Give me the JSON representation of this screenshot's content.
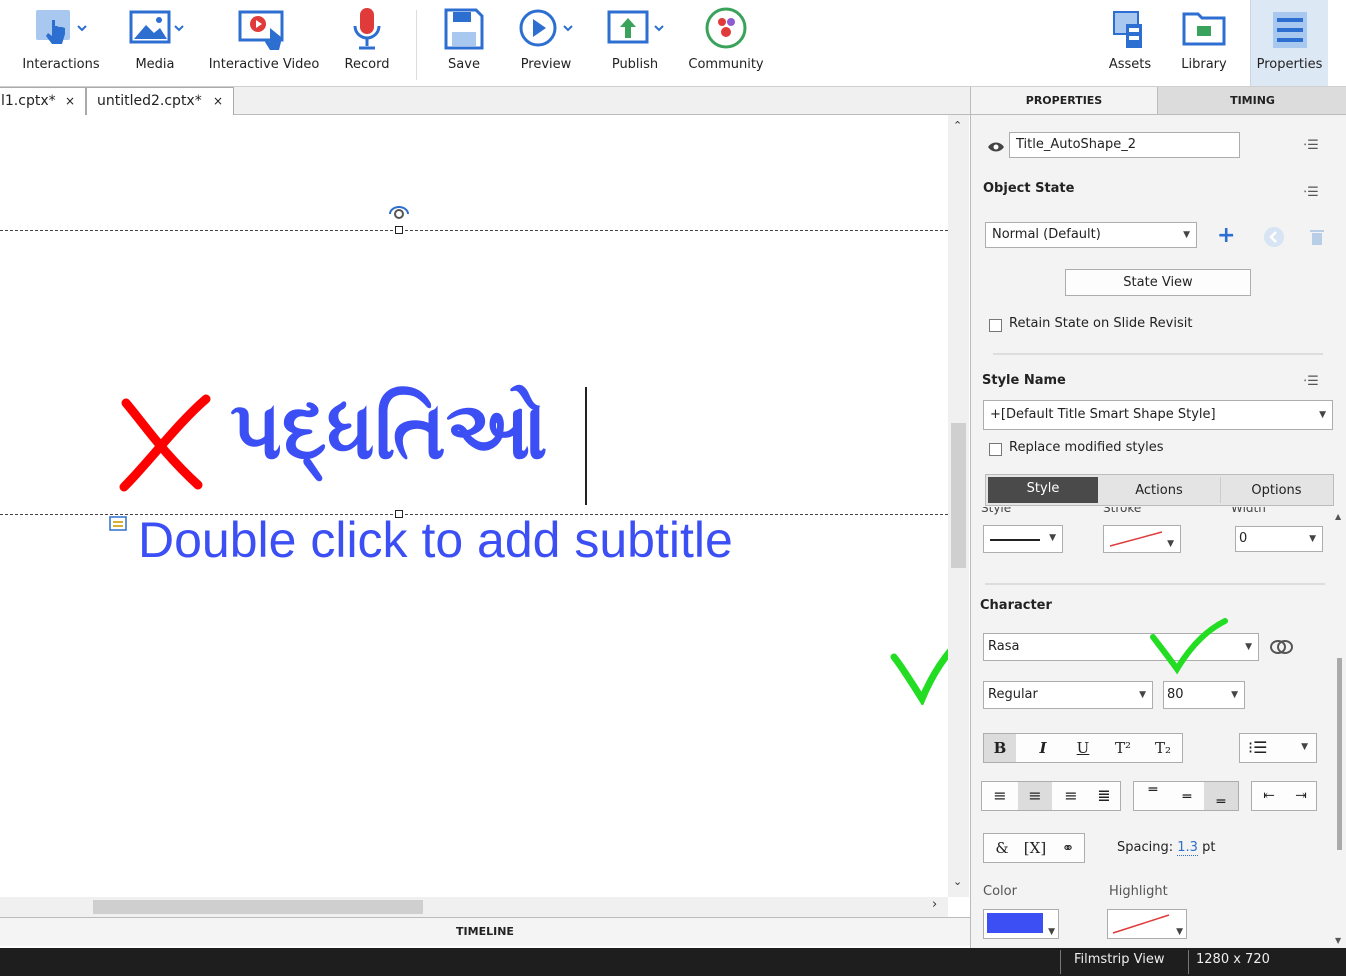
{
  "toolbar": {
    "interactions": "Interactions",
    "media": "Media",
    "interactive_video": "Interactive Video",
    "record": "Record",
    "save": "Save",
    "preview": "Preview",
    "publish": "Publish",
    "community": "Community",
    "assets": "Assets",
    "library": "Library",
    "properties": "Properties"
  },
  "doc_tabs": [
    {
      "label": "l1.cptx*",
      "close": "×"
    },
    {
      "label": "untitled2.cptx*",
      "close": "×"
    }
  ],
  "slide": {
    "title_text": "પદ્ધતિઓ",
    "subtitle_placeholder": "Double click to add subtitle"
  },
  "timeline_label": "TIMELINE",
  "panel": {
    "tabs": [
      "PROPERTIES",
      "TIMING"
    ],
    "object_name": "Title_AutoShape_2",
    "object_state_label": "Object State",
    "state_value": "Normal (Default)",
    "state_view_button": "State View",
    "retain_state_label": "Retain State on Slide Revisit",
    "style_name_label": "Style Name",
    "style_name_value": "+[Default Title Smart Shape Style]",
    "replace_styles_label": "Replace modified styles",
    "subtabs": [
      "Style",
      "Actions",
      "Options"
    ],
    "style_label": "Style",
    "stroke_label": "Stroke",
    "width_label": "Width",
    "width_value": "0",
    "character_label": "Character",
    "font_family": "Rasa",
    "font_style": "Regular",
    "font_size": "80",
    "spacing_label": "Spacing:",
    "spacing_value": "1.3",
    "spacing_unit": "pt",
    "color_label": "Color",
    "highlight_label": "Highlight",
    "font_color": "#3b4ff5"
  },
  "status": {
    "filmstrip": "Filmstrip View",
    "resolution": "1280 x 720"
  },
  "annotations": {
    "cross_color": "#ff0000",
    "check_color": "#22dd22"
  }
}
